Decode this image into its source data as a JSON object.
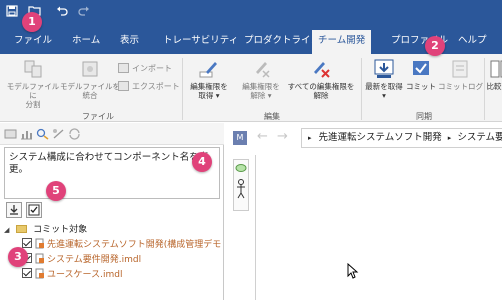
{
  "ribbon_tabs": [
    "ファイル",
    "ホーム",
    "表示",
    "トレーサビリティ",
    "プロダクトライン",
    "チーム開発",
    "プロファイル",
    "ヘルプ"
  ],
  "ribbon": {
    "file_group": {
      "split_label": "モデルファイルに\n分割",
      "merge_label": "モデルファイルを\n統合",
      "import_label": "インポート",
      "export_label": "エクスポート",
      "group_label": "ファイル"
    },
    "edit_group": {
      "acquire_label": "編集権限を\n取得 ▾",
      "release_label": "編集権限を\n解除 ▾",
      "release_all_label": "すべての編集権限を\n解除",
      "group_label": "編集"
    },
    "sync_group": {
      "update_label": "最新を取得\n▾",
      "commit_label": "コミット",
      "log_label": "コミットログ",
      "group_label": "同期"
    },
    "compare_label": "比較"
  },
  "commit_message": "システム構成に合わせてコンポーネント名を変更。",
  "tree": {
    "root_label": "コミット対象",
    "items": [
      {
        "label": "先進運転システムソフト開発(構成管理デモ"
      },
      {
        "label": "システム要件開発.imdl"
      },
      {
        "label": "ユースケース.imdl"
      }
    ]
  },
  "breadcrumb": [
    "先進運転システムソフト開発",
    "システム要件開発"
  ],
  "mode_badge": "M",
  "markers": [
    "1",
    "2",
    "3",
    "4",
    "5"
  ],
  "colors": {
    "titlebar": "#2b579a",
    "accent_marker": "#e0427a",
    "tree_text": "#b8652b"
  }
}
